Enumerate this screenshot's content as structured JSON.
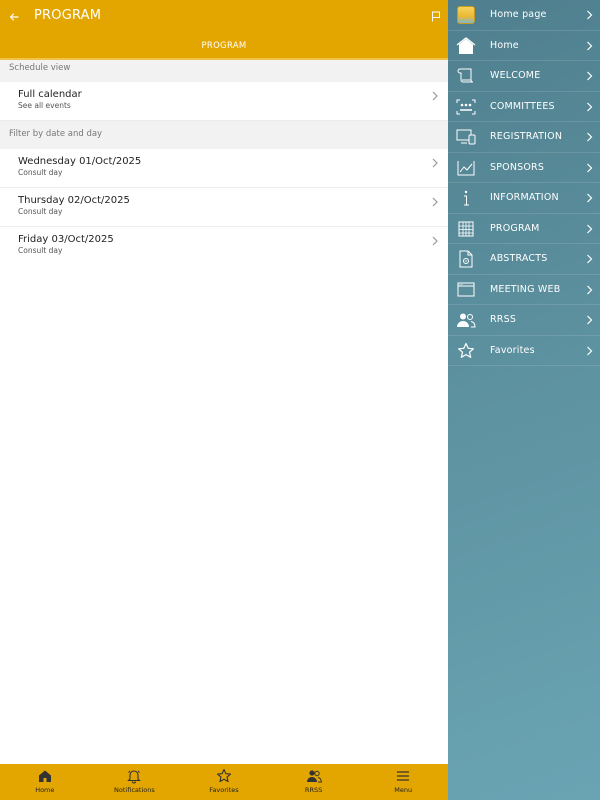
{
  "header": {
    "title": "PROGRAM",
    "subtitle": "PROGRAM"
  },
  "schedule": {
    "section_label": "Schedule view",
    "full_calendar": {
      "label": "Full calendar",
      "sub": "See all events"
    }
  },
  "filter": {
    "section_label": "Filter by date and day",
    "days": [
      {
        "label": "Wednesday 01/Oct/2025",
        "sub": "Consult day"
      },
      {
        "label": "Thursday 02/Oct/2025",
        "sub": "Consult day"
      },
      {
        "label": "Friday 03/Oct/2025",
        "sub": "Consult day"
      }
    ]
  },
  "bottom_nav": {
    "items": [
      {
        "label": "Home",
        "icon": "home-icon"
      },
      {
        "label": "Notifications",
        "icon": "bell-icon"
      },
      {
        "label": "Favorites",
        "icon": "star-icon"
      },
      {
        "label": "RRSS",
        "icon": "people-icon"
      },
      {
        "label": "Menu",
        "icon": "hamburger-icon"
      }
    ]
  },
  "side_menu": {
    "items": [
      {
        "label": "Home page",
        "icon": "logo-icon"
      },
      {
        "label": "Home",
        "icon": "house-icon"
      },
      {
        "label": "WELCOME",
        "icon": "scroll-icon"
      },
      {
        "label": "COMMITTEES",
        "icon": "committee-icon"
      },
      {
        "label": "REGISTRATION",
        "icon": "devices-icon"
      },
      {
        "label": "SPONSORS",
        "icon": "chart-icon"
      },
      {
        "label": "INFORMATION",
        "icon": "info-icon"
      },
      {
        "label": "PROGRAM",
        "icon": "calendar-grid-icon"
      },
      {
        "label": "ABSTRACTS",
        "icon": "document-icon"
      },
      {
        "label": "MEETING WEB",
        "icon": "browser-window-icon"
      },
      {
        "label": "RRSS",
        "icon": "people-icon"
      },
      {
        "label": "Favorites",
        "icon": "star-icon"
      }
    ]
  },
  "colors": {
    "accent": "#e3a600",
    "side_menu_start": "#4f7f8e",
    "side_menu_end": "#6aa4b3"
  }
}
